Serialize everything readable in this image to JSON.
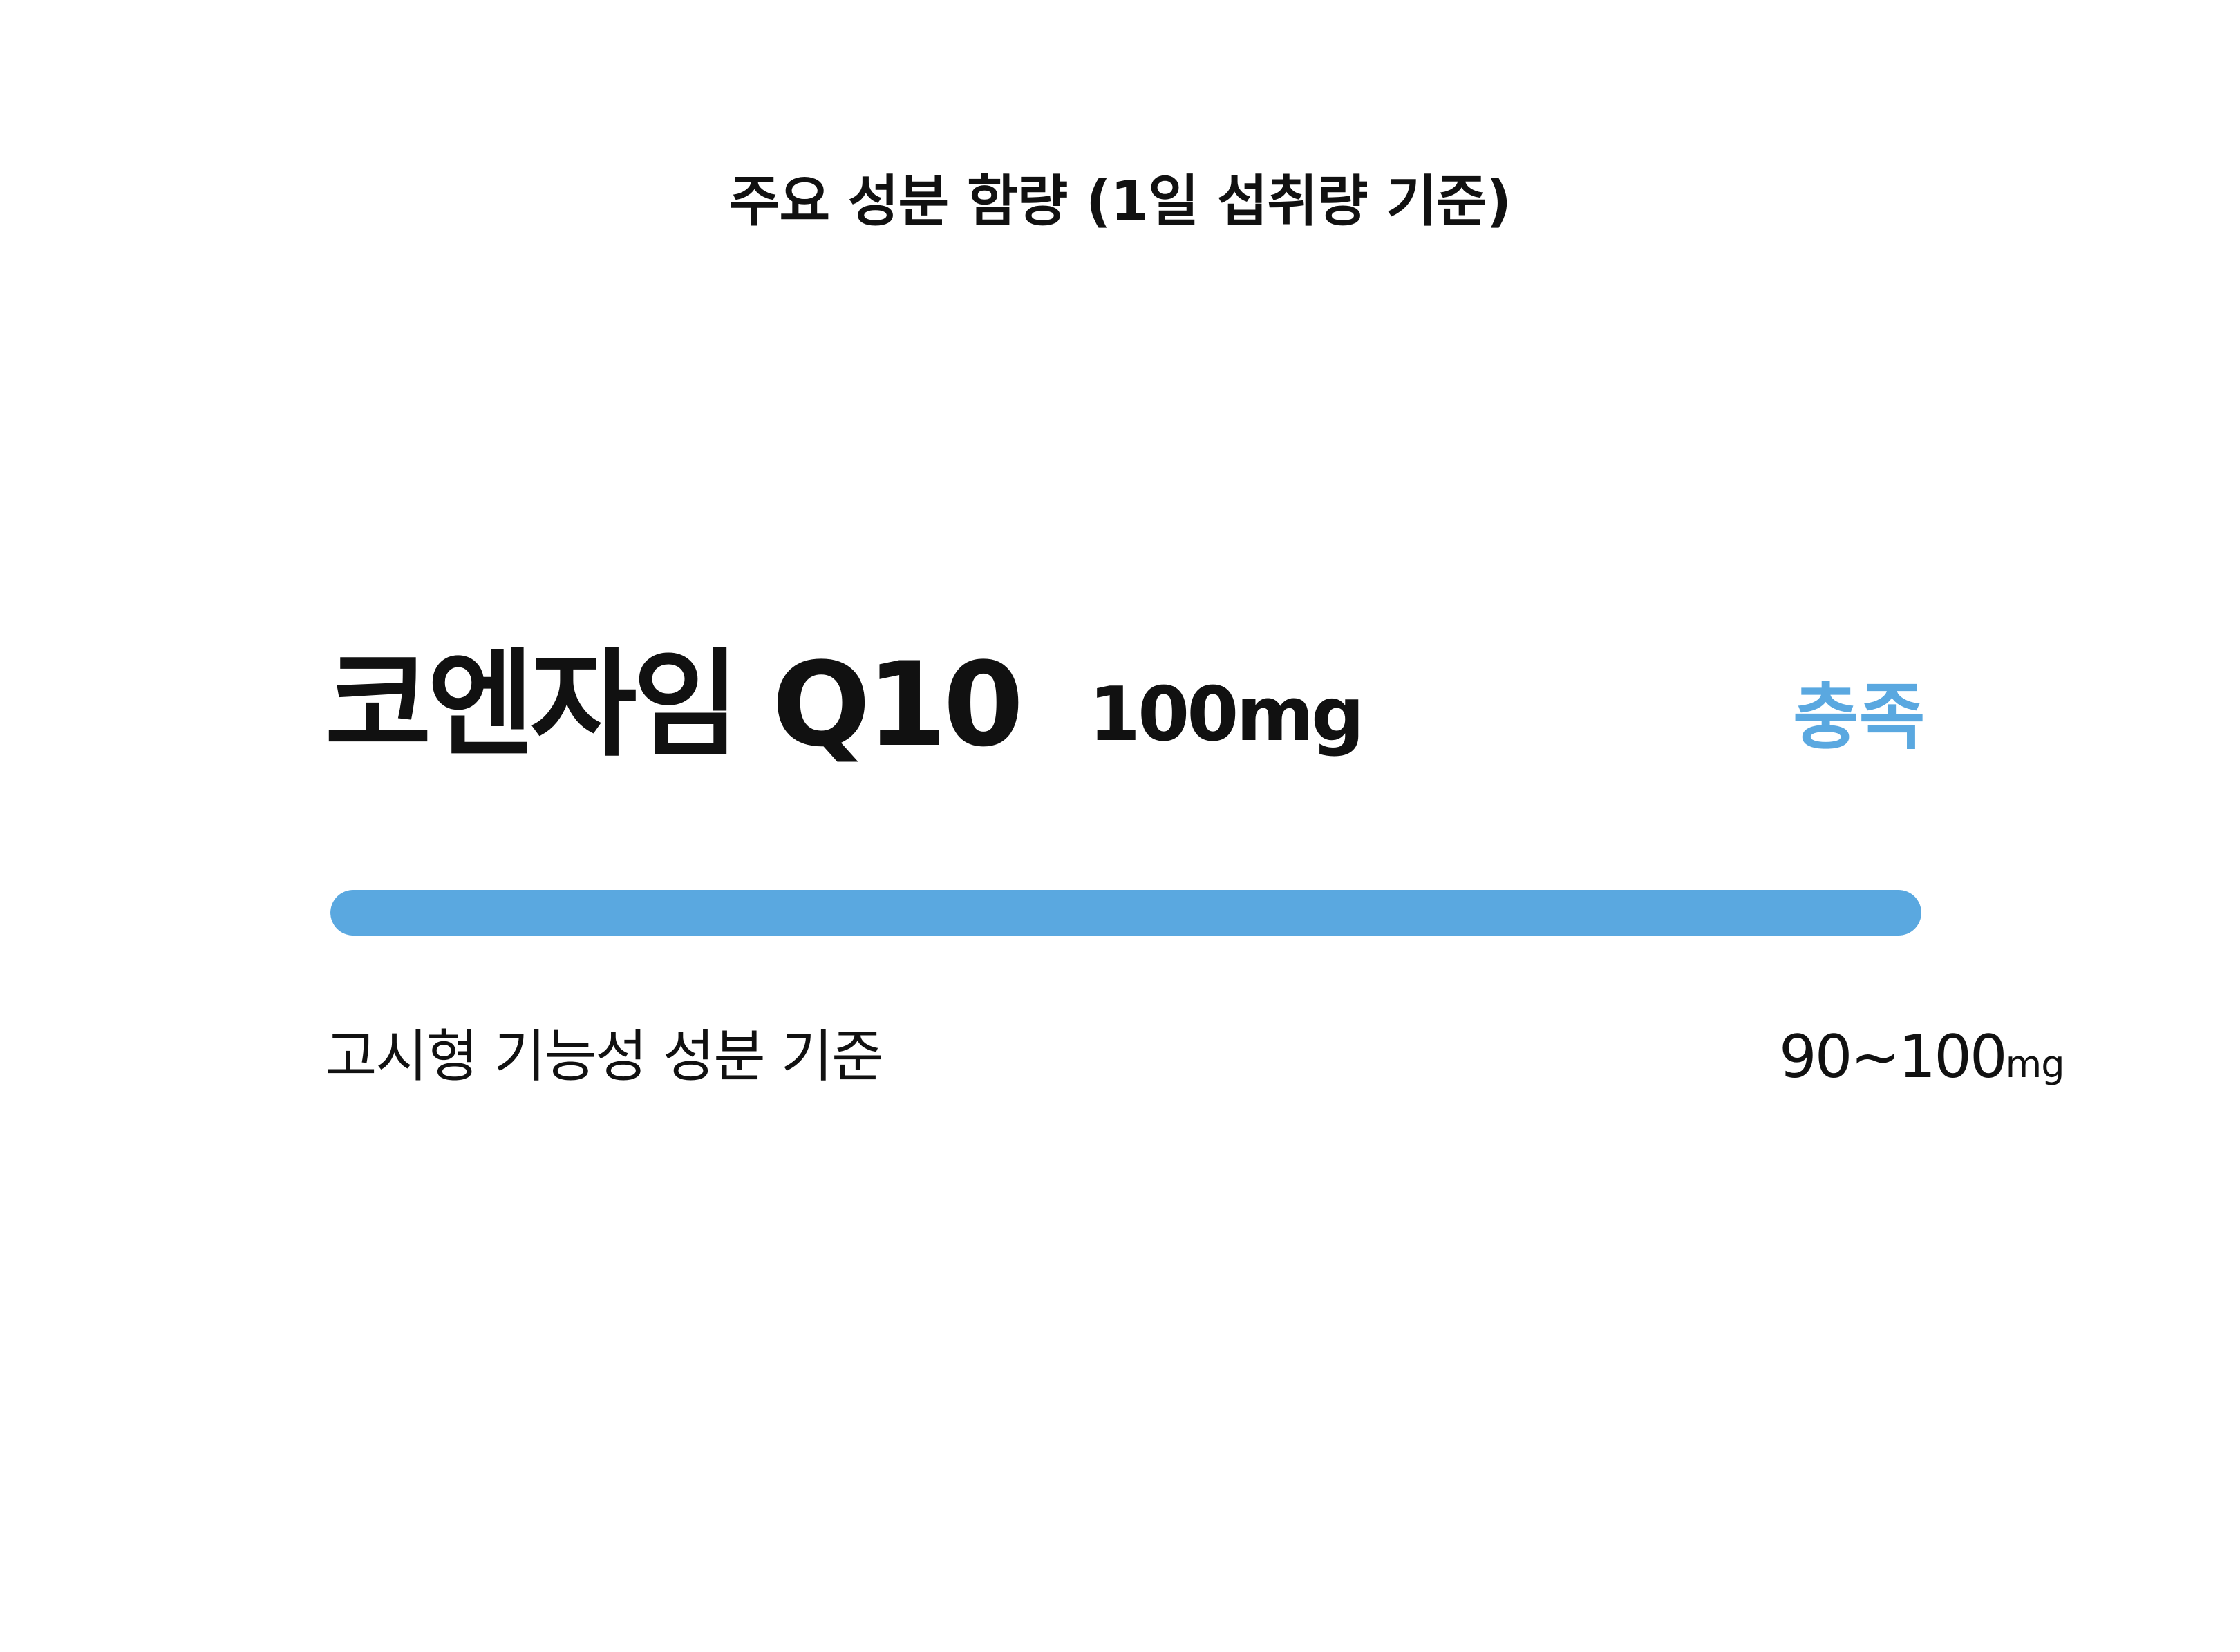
{
  "page": {
    "title": "주요 성분 함량 (1일 섭취량 기준)"
  },
  "ingredient": {
    "name": "코엔자임 Q10",
    "amount": "100mg",
    "status": "충족",
    "status_color": "#5aa8e0",
    "progress_fraction": 1.0,
    "progress_color": "#5aa8e0"
  },
  "standard": {
    "label": "고시형 기능성 성분 기준",
    "range_value": "90~100",
    "range_unit": "mg"
  }
}
